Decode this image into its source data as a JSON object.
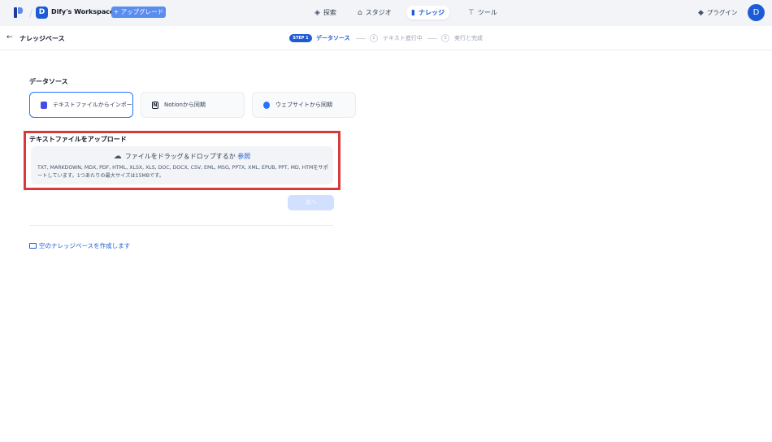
{
  "nav": {
    "workspace_initial": "D",
    "workspace_name": "Dify's Workspace",
    "workspace_chevron": "⌄",
    "upgrade_label": "アップグレード",
    "upgrade_icon": "+",
    "items": [
      {
        "label": "探索",
        "icon": "compass-icon"
      },
      {
        "label": "スタジオ",
        "icon": "robot-icon"
      },
      {
        "label": "ナレッジ",
        "icon": "book-icon"
      },
      {
        "label": "ツール",
        "icon": "wrench-icon"
      }
    ],
    "plugin_label": "プラグイン",
    "user_initial": "D"
  },
  "subheader": {
    "back_icon": "←",
    "title": "ナレッジベース",
    "steps": [
      {
        "badge": "STEP 1",
        "label": "データソース",
        "active": true
      },
      {
        "number": "2",
        "label": "テキスト進行中",
        "active": false
      },
      {
        "number": "3",
        "label": "実行と完成",
        "active": false
      }
    ]
  },
  "datasource": {
    "title": "データソース",
    "options": [
      {
        "label": "テキストファイルからインポート",
        "icon": "file-icon",
        "selected": true
      },
      {
        "label": "Notionから同期",
        "icon": "notion-icon",
        "selected": false
      },
      {
        "label": "ウェブサイトから同期",
        "icon": "globe-icon",
        "selected": false
      }
    ]
  },
  "upload": {
    "title": "テキストファイルをアップロード",
    "drop_text": "ファイルをドラッグ＆ドロップするか",
    "browse_label": "参照",
    "supported": "TXT, MARKDOWN, MDX, PDF, HTML, XLSX, XLS, DOC, DOCX, CSV, EML, MSG, PPTX, XML, EPUB, PPT, MD, HTMをサポートしています。1つあたりの最大サイズは15MBです。"
  },
  "next_label": "次へ",
  "empty_kb_label": "空のナレッジベースを作成します",
  "colors": {
    "accent": "#1d5bd6",
    "highlight": "#d63a3a"
  }
}
